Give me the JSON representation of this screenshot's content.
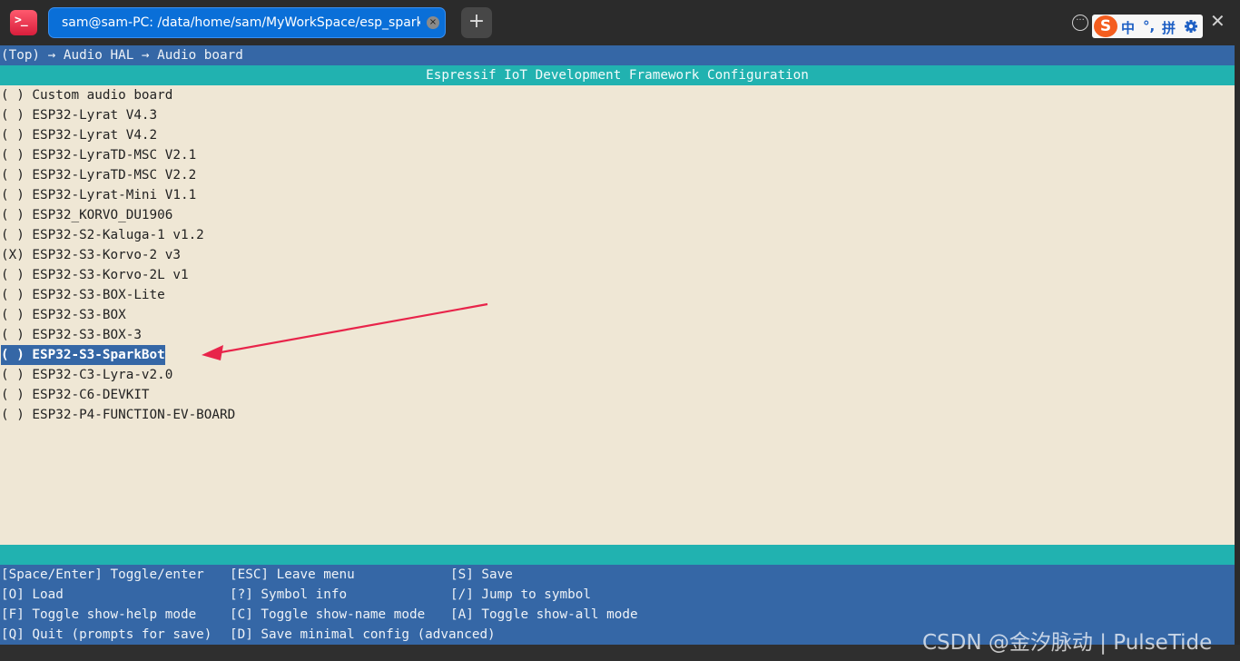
{
  "window": {
    "tab_title": "sam@sam-PC: /data/home/sam/MyWorkSpace/esp_sparkbo···",
    "new_tab_label": "+",
    "ime": {
      "logo": "S",
      "items": [
        "中",
        "°,",
        "拼"
      ]
    }
  },
  "terminal": {
    "breadcrumb": "(Top) → Audio HAL → Audio board",
    "header": "Espressif IoT Development Framework Configuration",
    "items": [
      {
        "text": "( ) Custom audio board"
      },
      {
        "text": "( ) ESP32-Lyrat V4.3"
      },
      {
        "text": "( ) ESP32-Lyrat V4.2"
      },
      {
        "text": "( ) ESP32-LyraTD-MSC V2.1"
      },
      {
        "text": "( ) ESP32-LyraTD-MSC V2.2"
      },
      {
        "text": "( ) ESP32-Lyrat-Mini V1.1"
      },
      {
        "text": "( ) ESP32_KORVO_DU1906"
      },
      {
        "text": "( ) ESP32-S2-Kaluga-1 v1.2"
      },
      {
        "text": "(X) ESP32-S3-Korvo-2 v3"
      },
      {
        "text": "( ) ESP32-S3-Korvo-2L v1"
      },
      {
        "text": "( ) ESP32-S3-BOX-Lite"
      },
      {
        "text": "( ) ESP32-S3-BOX"
      },
      {
        "text": "( ) ESP32-S3-BOX-3"
      },
      {
        "text": "( ) ESP32-S3-SparkBot"
      },
      {
        "text": "( ) ESP32-C3-Lyra-v2.0"
      },
      {
        "text": "( ) ESP32-C6-DEVKIT"
      },
      {
        "text": "( ) ESP32-P4-FUNCTION-EV-BOARD"
      }
    ],
    "selected_index": 13,
    "help": [
      [
        "[Space/Enter] Toggle/enter",
        "[ESC] Leave menu",
        "[S] Save"
      ],
      [
        "[O] Load",
        "[?] Symbol info",
        "[/] Jump to symbol"
      ],
      [
        "[F] Toggle show-help mode",
        "[C] Toggle show-name mode",
        "[A] Toggle show-all mode"
      ],
      [
        "[Q] Quit (prompts for save)",
        "[D] Save minimal config (advanced)",
        ""
      ]
    ]
  },
  "watermark": "CSDN @金汐脉动 | PulseTide",
  "colors": {
    "breadcrumb_bg": "#3567a6",
    "header_bg": "#21b2b0",
    "main_bg": "#efe7d5",
    "selection_bg": "#3567a6",
    "arrow": "#e8244a"
  }
}
